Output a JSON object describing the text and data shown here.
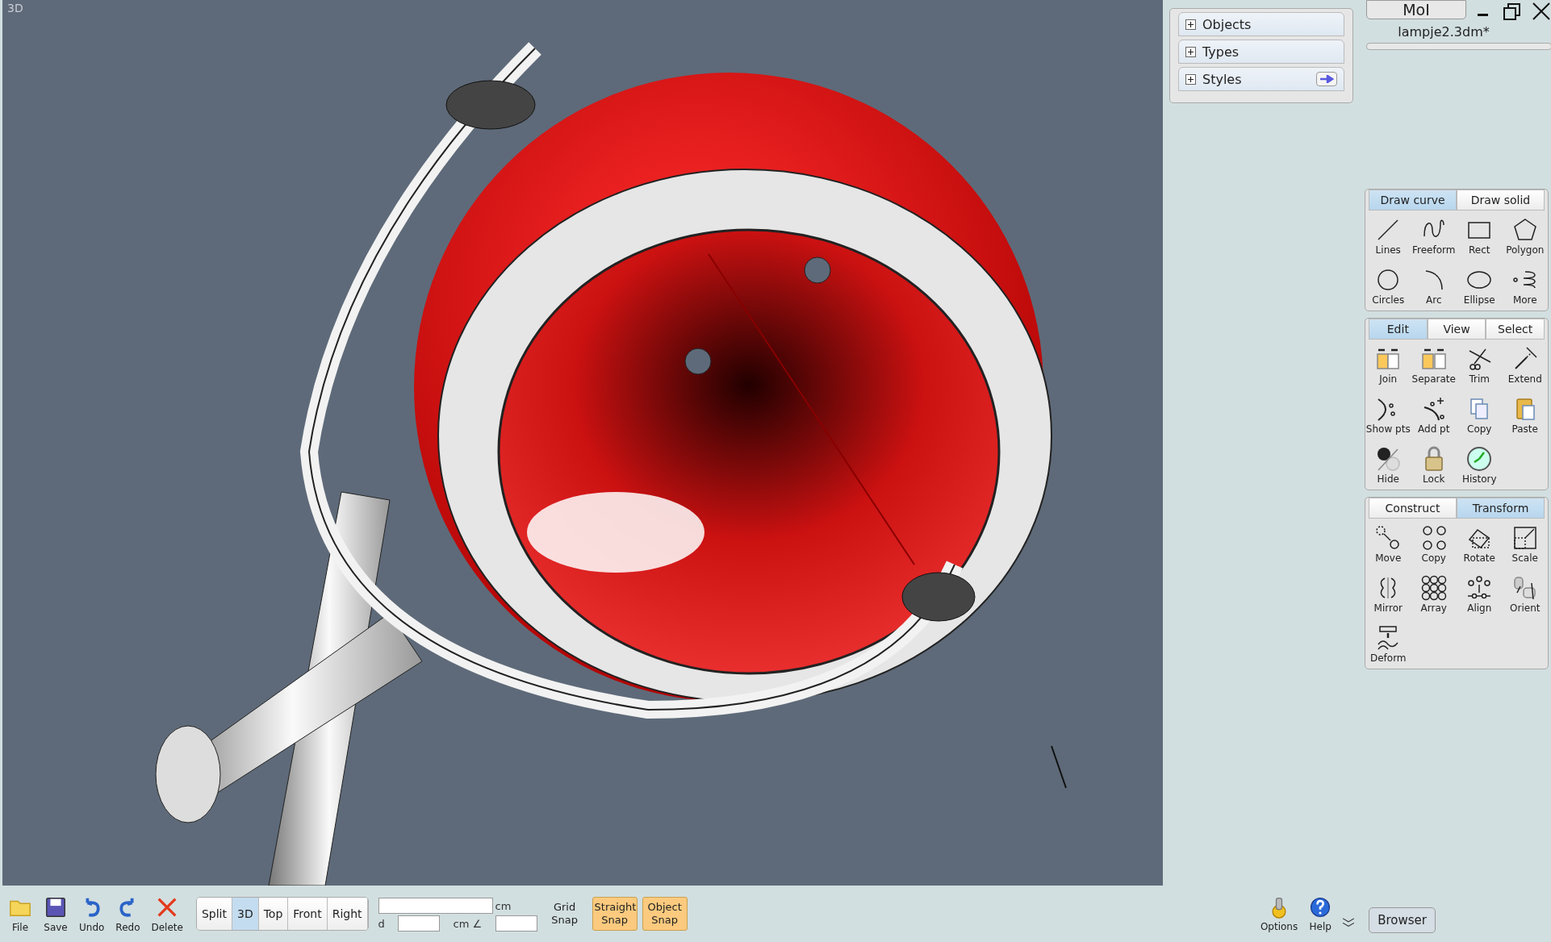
{
  "viewport": {
    "label": "3D"
  },
  "browser_sections": [
    {
      "label": "Objects",
      "arrow": false
    },
    {
      "label": "Types",
      "arrow": false
    },
    {
      "label": "Styles",
      "arrow": true
    }
  ],
  "app_button": "MoI",
  "file_name": "lampje2.3dm*",
  "tool_palettes": [
    {
      "tabs": [
        {
          "label": "Draw curve",
          "selected": true
        },
        {
          "label": "Draw solid",
          "selected": false
        }
      ],
      "tools": [
        "Lines",
        "Freeform",
        "Rect",
        "Polygon",
        "Circles",
        "Arc",
        "Ellipse",
        "More"
      ]
    },
    {
      "tabs": [
        {
          "label": "Edit",
          "selected": true
        },
        {
          "label": "View",
          "selected": false
        },
        {
          "label": "Select",
          "selected": false
        }
      ],
      "tools": [
        "Join",
        "Separate",
        "Trim",
        "Extend",
        "Show pts",
        "Add pt",
        "Copy",
        "Paste",
        "Hide",
        "Lock",
        "History"
      ]
    },
    {
      "tabs": [
        {
          "label": "Construct",
          "selected": false
        },
        {
          "label": "Transform",
          "selected": true
        }
      ],
      "tools": [
        "Move",
        "Copy",
        "Rotate",
        "Scale",
        "Mirror",
        "Array",
        "Align",
        "Orient",
        "Deform"
      ]
    }
  ],
  "bottom_toolbar": {
    "file_buttons": [
      "File",
      "Save",
      "Undo",
      "Redo",
      "Delete"
    ],
    "view_tabs": [
      {
        "label": "Split",
        "selected": false
      },
      {
        "label": "3D",
        "selected": true
      },
      {
        "label": "Top",
        "selected": false
      },
      {
        "label": "Front",
        "selected": false
      },
      {
        "label": "Right",
        "selected": false
      }
    ],
    "coord_unit": "cm",
    "distance_label": "d",
    "distance_unit": "cm",
    "angle_symbol": "∠",
    "snaps": [
      {
        "label": "Grid Snap",
        "on": false
      },
      {
        "label": "Straight Snap",
        "on": true
      },
      {
        "label": "Object Snap",
        "on": true
      }
    ],
    "right_buttons": [
      "Options",
      "Help"
    ],
    "browser_button": "Browser"
  }
}
